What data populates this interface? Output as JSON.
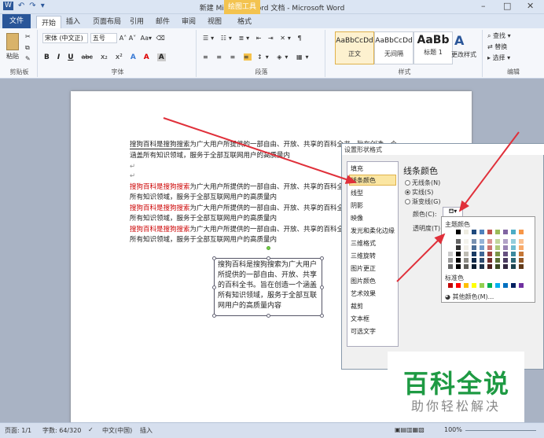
{
  "window": {
    "title": "新建 Microsoft Word 文档 - Microsoft Word",
    "context_tab": "绘图工具",
    "qat": [
      "W",
      "↶",
      "↷",
      "▾"
    ]
  },
  "tabs": [
    "文件",
    "开始",
    "插入",
    "页面布局",
    "引用",
    "邮件",
    "审阅",
    "视图",
    "格式"
  ],
  "ribbon": {
    "clipboard": {
      "paste": "粘贴",
      "label": "剪贴板"
    },
    "font": {
      "name": "宋体 (中文正)",
      "size": "五号",
      "label": "字体",
      "buttons": [
        "B",
        "I",
        "U",
        "abc",
        "x₂",
        "x²",
        "A",
        "A",
        "A"
      ]
    },
    "paragraph": {
      "label": "段落"
    },
    "styles": {
      "label": "样式",
      "items": [
        {
          "preview": "AaBbCcDd",
          "name": "正文"
        },
        {
          "preview": "AaBbCcDd",
          "name": "无间隔"
        },
        {
          "preview": "AaBb",
          "name": "标题 1"
        }
      ],
      "change": "更改样式"
    },
    "editing": {
      "label": "编辑",
      "find": "查找",
      "replace": "替换",
      "select": "选择"
    }
  },
  "doc": {
    "lines": [
      {
        "a": "搜狗百科是搜狗搜索",
        "b": "为广大用户所提供的一部自由、开放、共享的百科全书，旨在创造一个"
      },
      {
        "a": "",
        "b": "涵盖所有知识领域，服务于全部互联网用户的高质量内"
      },
      {
        "a": "搜狗百科是搜狗搜索",
        "b": "为广大用户所提供的一部自由、开放、共享的百科全书"
      },
      {
        "a": "",
        "b": "所有知识领域，服务于全部互联网用户的高质量内"
      },
      {
        "a": "搜狗百科是搜狗搜索",
        "b": "为广大用户所提供的一部自由、开放、共享的百科全书"
      },
      {
        "a": "",
        "b": "所有知识领域，服务于全部互联网用户的高质量内"
      },
      {
        "a": "搜狗百科是搜狗搜索",
        "b": "为广大用户所提供的一部自由、开放、共享的百科全书"
      },
      {
        "a": "",
        "b": "所有知识领域，服务于全部互联网用户的高质量内"
      }
    ],
    "textbox": "搜狗百科是搜狗搜索为广大用户所提供的一部自由、开放、共享的百科全书。旨在创造一个涵盖所有知识领域，服务于全部互联网用户的高质量内容"
  },
  "dialog": {
    "title": "设置形状格式",
    "nav": [
      "填充",
      "线条颜色",
      "线型",
      "阴影",
      "映像",
      "发光和柔化边缘",
      "三维格式",
      "三维旋转",
      "图片更正",
      "图片颜色",
      "艺术效果",
      "裁剪",
      "文本框",
      "可选文字"
    ],
    "heading": "线条颜色",
    "options": [
      "无线条(N)",
      "实线(S)",
      "渐变线(G)"
    ],
    "color_label": "颜色(C):",
    "transparency_label": "透明度(T):",
    "palette_theme": "主题颜色",
    "palette_standard": "标准色",
    "palette_more": "其他颜色(M)..."
  },
  "status": {
    "page": "页面: 1/1",
    "words": "字数: 64/320",
    "lang": "中文(中国)",
    "mode": "插入",
    "zoom": "100%"
  },
  "watermark": {
    "title": "百科全说",
    "subtitle": "助你轻松解决"
  },
  "colors": {
    "accent": "#2a5699",
    "arrow": "#e0303a",
    "watermark": "#1e9a43"
  }
}
